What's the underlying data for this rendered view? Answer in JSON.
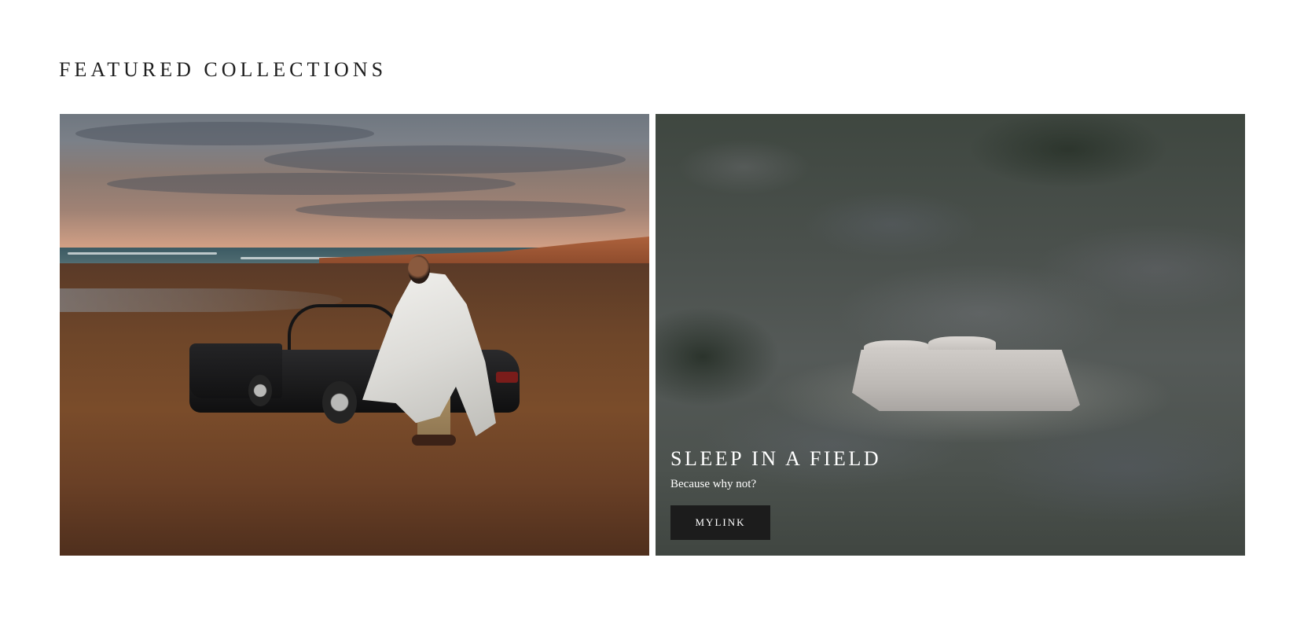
{
  "section": {
    "title": "FEATURED COLLECTIONS"
  },
  "cards": [
    {
      "image_alt": "Man wrapped in white duvet leaning on convertible car on beach at sunset"
    },
    {
      "image_alt": "Bed with pillows in a field of shrubs",
      "heading": "SLEEP IN A FIELD",
      "text": "Because why not?",
      "button_label": "MYLINK"
    }
  ]
}
